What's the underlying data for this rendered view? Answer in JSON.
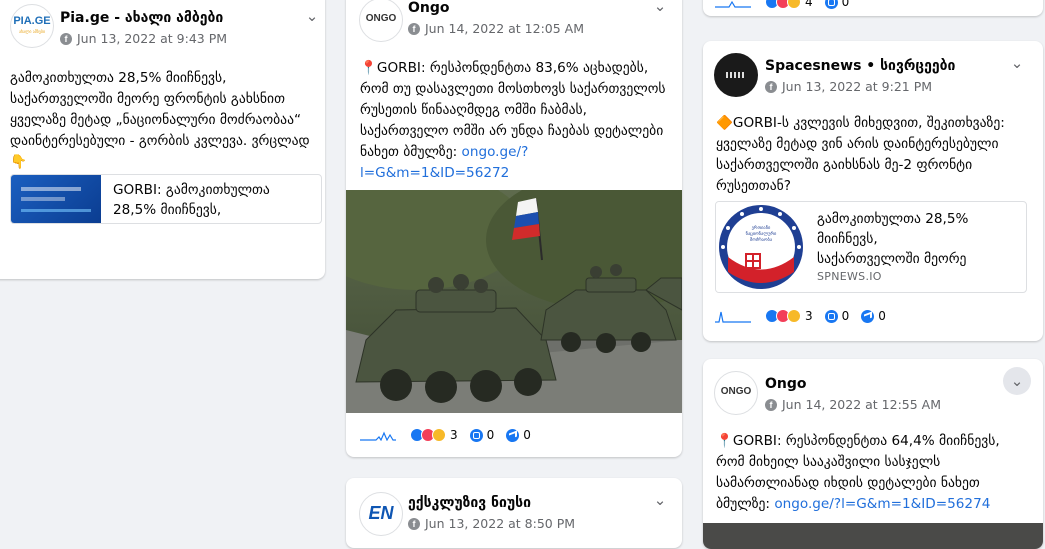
{
  "posts": {
    "pia": {
      "name": "Pia.ge - ახალი ამბები",
      "time": "Jun 13, 2022 at 9:43 PM",
      "text": "გამოკითხულთა 28,5% მიიჩნევს, საქართველოში მეორე ფრონტის გახსნით ყველაზე მეტად „ნაციონალური მოძრაობაა“ დაინტერესებული - გორბის კვლევა. ვრცლად 👇",
      "preview_title": "GORBI: გამოკითხულთა\n28,5% მიიჩნევს,",
      "logo_line1": "PIA.GE",
      "logo_line2": "ახალი ამბები"
    },
    "ongo1": {
      "name": "Ongo",
      "time": "Jun 14, 2022 at 12:05 AM",
      "text": "📍GORBI: რესპონდენტთა 83,6% აცხადებს, რომ თუ დასავლეთი მოსთხოვს საქართველოს რუსეთის წინააღმდეგ ომში ჩაბმას, საქართველო ომში არ უნდა ჩაებას დეტალები ნახეთ ბმულზე: ",
      "link": "ongo.ge/?l=G&m=1&ID=56272",
      "logo": "ONGO",
      "reactions": "3",
      "comments": "0",
      "shares": "0"
    },
    "exclusive": {
      "name": "ექსკლუზივ ნიუსი",
      "time": "Jun 13, 2022 at 8:50 PM",
      "logo": "EN"
    },
    "top_right": {
      "reactions": "4",
      "comments": "0"
    },
    "spacesnews": {
      "name": "Spacesnews • სივრცეები",
      "time": "Jun 13, 2022 at 9:21 PM",
      "text": "🔶GORBI-ს კვლევის მიხედვით, შეკითხვაზე: ყველაზე მეტად ვინ არის დაინტერესებული საქართველოში გაიხსნას მე-2 ფრონტი რუსეთთან?",
      "preview_title": "გამოკითხულთა 28,5%\nმიიჩნევს,\nსაქართველოში მეორე",
      "preview_domain": "SPNEWS.IO",
      "badge_text": "ერთიანი ნაციონალური მოძრაობა",
      "reactions": "3",
      "comments": "0",
      "shares": "0"
    },
    "ongo2": {
      "name": "Ongo",
      "time": "Jun 14, 2022 at 12:55 AM",
      "text": "📍GORBI: რესპონდენტთა 64,4% მიიჩნევს, რომ მიხეილ სააკაშვილი სასჯელს სამართლიანად იხდის დეტალები ნახეთ ბმულზე: ",
      "link": "ongo.ge/?l=G&m=1&ID=56274",
      "logo": "ONGO"
    }
  },
  "colors": {
    "accent": "#1877f2",
    "link": "#216fdb",
    "meta": "#65676b",
    "background": "#f0f2f5"
  },
  "icons": {
    "globe": "facebook-icon",
    "menu": "chevron-down-icon",
    "comment": "comment-icon",
    "share": "share-icon",
    "sparkline": "sparkline-icon"
  }
}
